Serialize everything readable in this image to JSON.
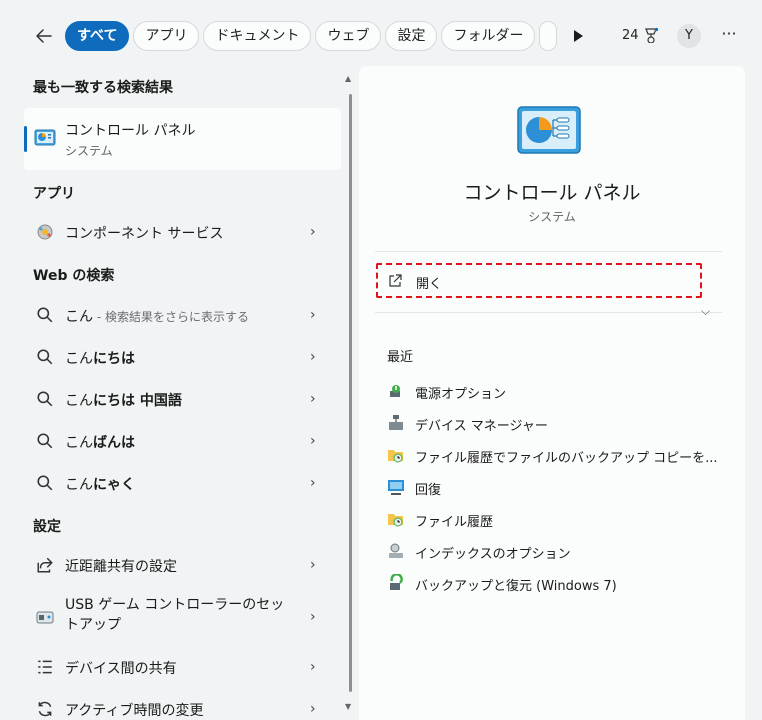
{
  "topbar": {
    "chips": [
      "すべて",
      "アプリ",
      "ドキュメント",
      "ウェブ",
      "設定",
      "フォルダー"
    ],
    "points": "24",
    "avatar": "Y",
    "more": "···"
  },
  "left": {
    "best_match_header": "最も一致する検索結果",
    "best_match": {
      "title": "コントロール パネル",
      "subtitle": "システム"
    },
    "apps_header": "アプリ",
    "apps": [
      {
        "label": "コンポーネント サービス"
      }
    ],
    "web_header": "Web の検索",
    "web": [
      {
        "prefix": "こん",
        "bold": "",
        "hint": " - 検索結果をさらに表示する"
      },
      {
        "prefix": "こん",
        "bold": "にちは",
        "hint": ""
      },
      {
        "prefix": "こん",
        "bold": "にちは 中国語",
        "hint": ""
      },
      {
        "prefix": "こん",
        "bold": "ばんは",
        "hint": ""
      },
      {
        "prefix": "こん",
        "bold": "にゃく",
        "hint": ""
      }
    ],
    "settings_header": "設定",
    "settings": [
      {
        "label": "近距離共有の設定"
      },
      {
        "label": "USB ゲーム コントローラーのセットアップ"
      },
      {
        "label": "デバイス間の共有"
      },
      {
        "label": "アクティブ時間の変更"
      }
    ]
  },
  "right": {
    "title": "コントロール パネル",
    "subtitle": "システム",
    "open_label": "開く",
    "recent_header": "最近",
    "recent": [
      {
        "label": "電源オプション",
        "icon": "power-options-icon"
      },
      {
        "label": "デバイス マネージャー",
        "icon": "device-manager-icon"
      },
      {
        "label": "ファイル履歴でファイルのバックアップ コピーを...",
        "icon": "file-history-icon"
      },
      {
        "label": "回復",
        "icon": "recovery-icon"
      },
      {
        "label": "ファイル履歴",
        "icon": "file-history-icon"
      },
      {
        "label": "インデックスのオプション",
        "icon": "indexing-options-icon"
      },
      {
        "label": "バックアップと復元 (Windows 7)",
        "icon": "backup-restore-icon"
      }
    ]
  },
  "colors": {
    "accent": "#0f6cbd",
    "highlight_border": "#e0131b"
  }
}
